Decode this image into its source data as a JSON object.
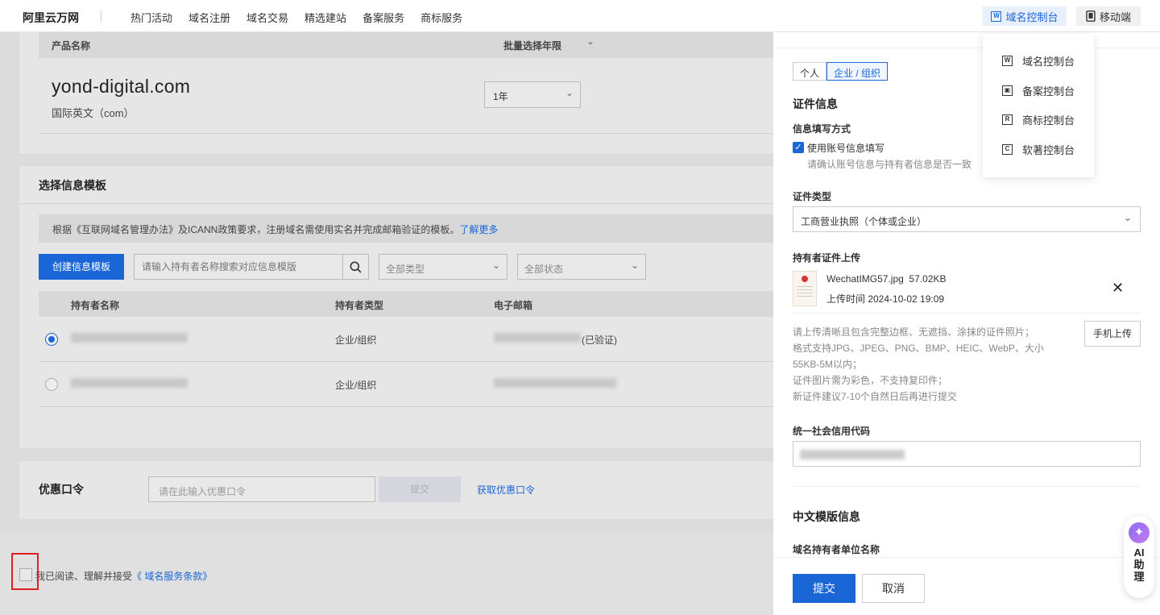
{
  "nav": {
    "logo": "阿里云万网",
    "links": [
      "热门活动",
      "域名注册",
      "域名交易",
      "精选建站",
      "备案服务",
      "商标服务"
    ],
    "console_label": "域名控制台",
    "console_icon": "W",
    "mobile_label": "移动端"
  },
  "product": {
    "col_name": "产品名称",
    "col_period": "批量选择年限",
    "domain": "yond-digital.com",
    "sub": "国际英文（com）",
    "year": "1年"
  },
  "template": {
    "title": "选择信息模板",
    "notice": "根据《互联网域名管理办法》及ICANN政策要求，注册域名需使用实名并完成邮箱验证的模板。",
    "learn_more": "了解更多",
    "create_btn": "创建信息模板",
    "search_placeholder": "请输入持有者名称搜索对应信息模版",
    "type_filter": "全部类型",
    "status_filter": "全部状态",
    "columns": [
      "持有者名称",
      "持有者类型",
      "电子邮箱"
    ],
    "rows": [
      {
        "type": "企业/组织",
        "mail_suffix": "(已验证)",
        "selected": true
      },
      {
        "type": "企业/组织",
        "mail_suffix": "",
        "selected": false
      }
    ]
  },
  "coupon": {
    "label": "优惠口令",
    "placeholder": "请在此输入优惠口令",
    "submit": "提交",
    "get": "获取优惠口令"
  },
  "agree": {
    "text": "我已阅读、理解并接受",
    "link": "《 域名服务条款》"
  },
  "panel": {
    "tab_personal": "个人",
    "tab_org": "企业 / 组织",
    "cert_section": "证件信息",
    "fill_method_label": "信息填写方式",
    "use_account": "使用账号信息填写",
    "use_account_tip": "请确认账号信息与持有者信息是否一致",
    "cert_type_label": "证件类型",
    "cert_type_value": "工商营业执照（个体或企业）",
    "upload_label": "持有者证件上传",
    "file_name": "WechatIMG57.jpg",
    "file_size": "57.02KB",
    "upload_time": "上传时间 2024-10-02 19:09",
    "tips": [
      "请上传清晰且包含完整边框、无遮挡、涂抹的证件照片；",
      "格式支持JPG、JPEG、PNG、BMP、HEIC、WebP、大小",
      "55KB-5M以内；",
      "证件图片需为彩色，不支持复印件；",
      "新证件建议7-10个自然日后再进行提交"
    ],
    "phone_upload": "手机上传",
    "credit_code_label": "统一社会信用代码",
    "cn_section": "中文模版信息",
    "holder_name_label": "域名持有者单位名称",
    "submit": "提交",
    "cancel": "取消"
  },
  "menu": {
    "items": [
      {
        "icon": "W",
        "label": "域名控制台"
      },
      {
        "icon": "▣",
        "label": "备案控制台"
      },
      {
        "icon": "R",
        "label": "商标控制台"
      },
      {
        "icon": "C",
        "label": "软著控制台"
      }
    ]
  },
  "ai": {
    "line1": "AI",
    "line2": "助",
    "line3": "理"
  }
}
